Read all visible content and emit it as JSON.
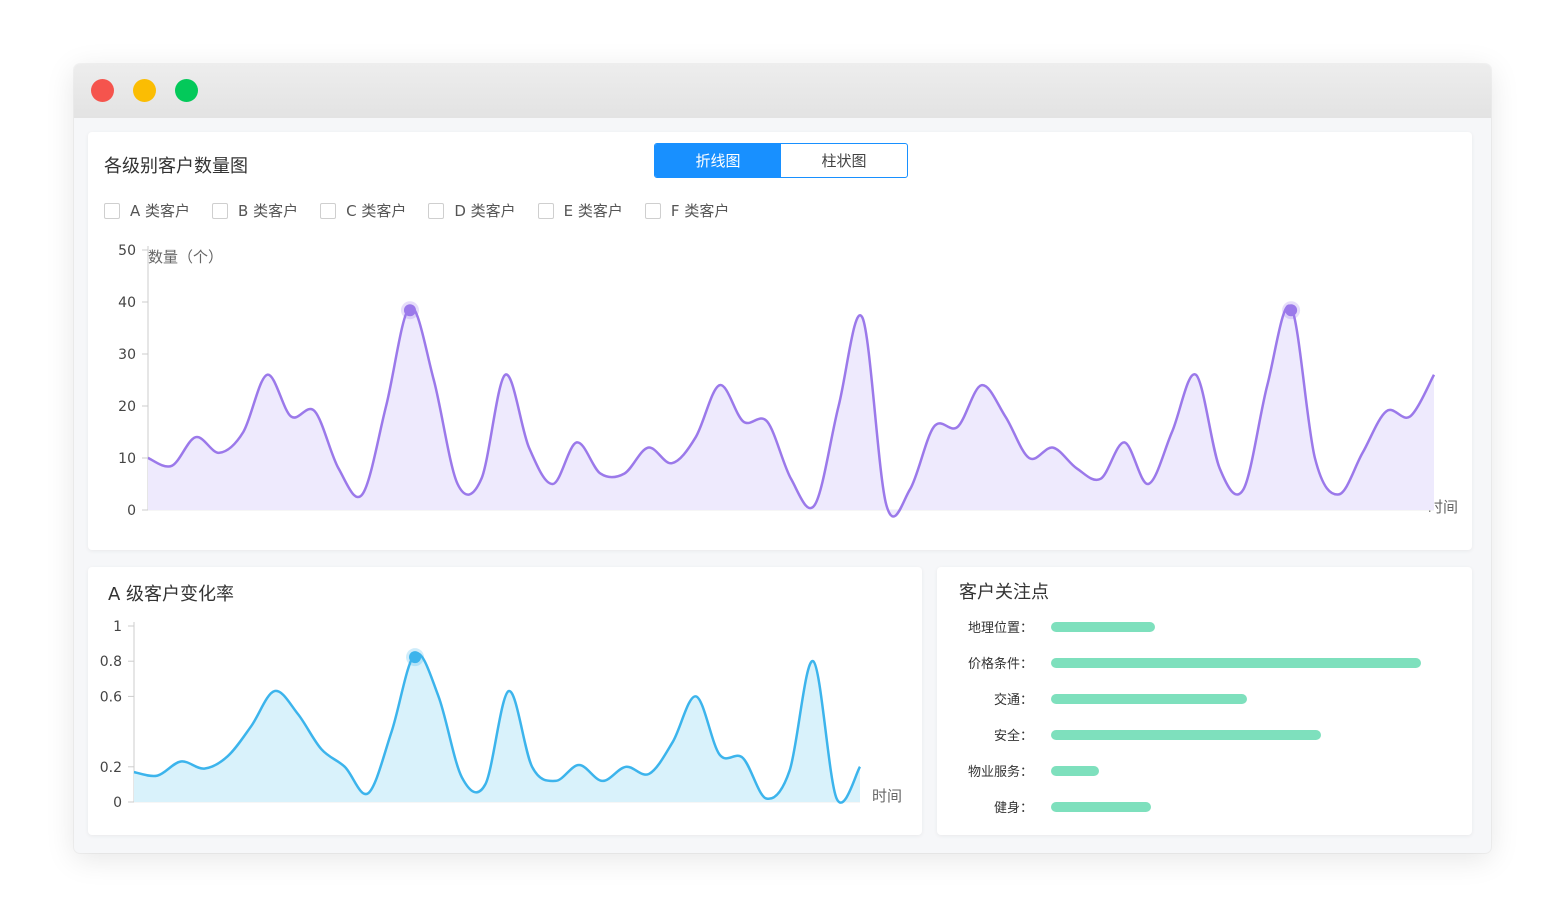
{
  "window": {
    "controls": [
      "close-icon",
      "minimize-icon",
      "maximize-icon"
    ],
    "colors": {
      "close": "#f5544d",
      "minimize": "#fbbd03",
      "maximize": "#03c95a"
    }
  },
  "customer_count_panel": {
    "title": "各级别客户数量图",
    "toggle": {
      "line_label": "折线图",
      "bar_label": "柱状图",
      "active": "line"
    },
    "filters": [
      "A 类客户",
      "B 类客户",
      "C 类客户",
      "D 类客户",
      "E 类客户",
      "F 类客户"
    ],
    "y_axis_title": "数量（个）",
    "x_axis_title": "时间",
    "y_ticks": [
      "0",
      "10",
      "20",
      "30",
      "40",
      "50"
    ],
    "line_color": "#9b79ea",
    "fill_color": "#eeeafd"
  },
  "rate_panel": {
    "title": "A 级客户变化率",
    "x_axis_title": "时间",
    "y_ticks": [
      "0",
      "0.2",
      "0.6",
      "0.8",
      "1"
    ],
    "line_color": "#3cb4ec",
    "fill_color": "#d9f2fb"
  },
  "focus_panel": {
    "title": "客户关注点",
    "items": [
      {
        "label": "地理位置：",
        "value": 0.28
      },
      {
        "label": "价格条件：",
        "value": 1.0
      },
      {
        "label": "交通：",
        "value": 0.53
      },
      {
        "label": "安全：",
        "value": 0.73
      },
      {
        "label": "物业服务：",
        "value": 0.13
      },
      {
        "label": "健身：",
        "value": 0.27
      }
    ],
    "bar_color": "#7ee0bd"
  },
  "chart_data": [
    {
      "type": "area",
      "title": "各级别客户数量图",
      "ylabel": "数量（个）",
      "xlabel": "时间",
      "ylim": [
        0,
        50
      ],
      "y_ticks": [
        0,
        10,
        20,
        30,
        40,
        50
      ],
      "grid": false,
      "series": [
        {
          "values": [
            10,
            8.5,
            14,
            11,
            15,
            26,
            18,
            19,
            8,
            3,
            20,
            39,
            25,
            5,
            6,
            26,
            12,
            5,
            13,
            7,
            7,
            12,
            9,
            14,
            24,
            17,
            17,
            6,
            1,
            20,
            37,
            1,
            4,
            16,
            16,
            24,
            18,
            10,
            12,
            8,
            6,
            13,
            5,
            15,
            26,
            8,
            4,
            24,
            39,
            10,
            3,
            11,
            19,
            18,
            26
          ]
        }
      ],
      "highlighted_points": [
        11,
        48
      ]
    },
    {
      "type": "area",
      "title": "A 级客户变化率",
      "xlabel": "时间",
      "ylim": [
        0,
        1
      ],
      "y_ticks": [
        0,
        0.2,
        0.6,
        0.8,
        1
      ],
      "grid": false,
      "series": [
        {
          "values": [
            0.17,
            0.15,
            0.23,
            0.19,
            0.26,
            0.43,
            0.63,
            0.5,
            0.3,
            0.2,
            0.05,
            0.4,
            0.84,
            0.6,
            0.14,
            0.1,
            0.63,
            0.2,
            0.12,
            0.21,
            0.12,
            0.2,
            0.16,
            0.34,
            0.6,
            0.27,
            0.25,
            0.02,
            0.18,
            0.8,
            0.02,
            0.2
          ]
        }
      ],
      "highlighted_points": [
        12
      ]
    }
  ]
}
